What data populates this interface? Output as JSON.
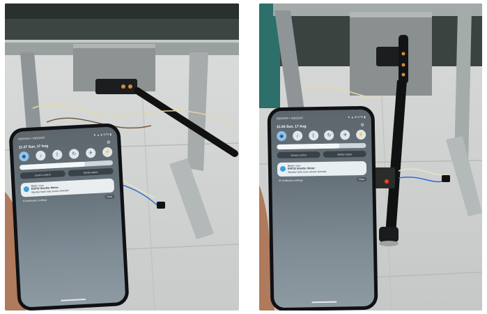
{
  "photos": [
    {
      "phone": {
        "carrier": "INDOSAT • INDOSAT",
        "status_icons": "▼ ▲ ⊕ 57% ▮",
        "clock": "11:27  Sun, 17 Aug",
        "device_control": "Device control",
        "media_output": "Media output",
        "notif_app": "Blynk",
        "notif_time": "• now",
        "notif_title": "ESP32 Standar Motor:",
        "notif_body": "Standar tidak naik secara otomatis",
        "notif_settings": "⚙ Notification settings",
        "clear": "Clear",
        "brightness": 0.7
      }
    },
    {
      "phone": {
        "carrier": "INDOSAT • INDOSAT",
        "status_icons": "▼ ▲ ⊕ 57% ▮",
        "clock": "11:26  Sun, 17 Aug",
        "device_control": "Device control",
        "media_output": "Media output",
        "notif_app": "Blynk",
        "notif_time": "• now",
        "notif_title": "ESP32 Standar Motor:",
        "notif_body": "Standar telah turun secara otomatis",
        "notif_settings": "⚙ Notification settings",
        "clear": "Clear",
        "brightness": 0.7
      }
    }
  ]
}
